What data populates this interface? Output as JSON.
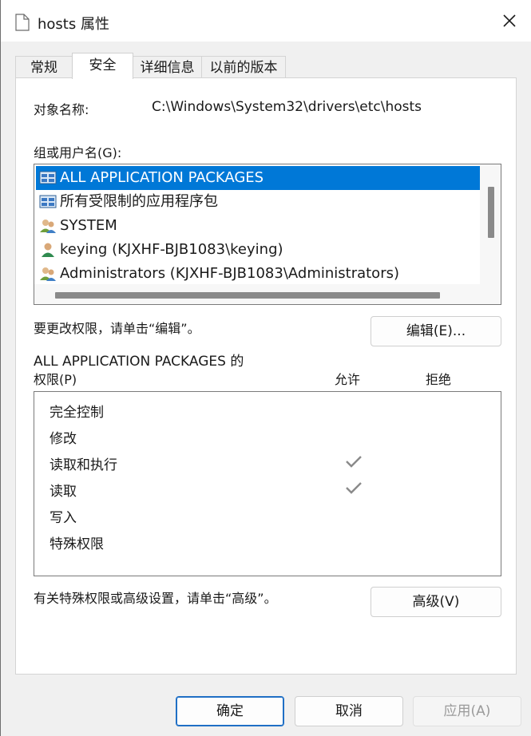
{
  "window": {
    "title": "hosts 属性"
  },
  "tabs": [
    {
      "label": "常规",
      "active": false
    },
    {
      "label": "安全",
      "active": true
    },
    {
      "label": "详细信息",
      "active": false
    },
    {
      "label": "以前的版本",
      "active": false
    }
  ],
  "security": {
    "object_label": "对象名称:",
    "object_value": "C:\\Windows\\System32\\drivers\\etc\\hosts",
    "groups_label": "组或用户名(G):",
    "groups": [
      {
        "name": "ALL APPLICATION PACKAGES",
        "icon": "app-packages-icon",
        "selected": true
      },
      {
        "name": "所有受限制的应用程序包",
        "icon": "app-packages-icon",
        "selected": false
      },
      {
        "name": "SYSTEM",
        "icon": "user-group-icon",
        "selected": false
      },
      {
        "name": "keying (KJXHF-BJB1083\\keying)",
        "icon": "user-icon",
        "selected": false
      },
      {
        "name": "Administrators (KJXHF-BJB1083\\Administrators)",
        "icon": "user-group-icon",
        "selected": false
      }
    ],
    "edit_hint": "要更改权限，请单击“编辑”。",
    "edit_button": "编辑(E)...",
    "perm_title": "ALL APPLICATION PACKAGES 的",
    "perm_label": "权限(P)",
    "allow_header": "允许",
    "deny_header": "拒绝",
    "permissions": [
      {
        "name": "完全控制",
        "allow": false,
        "deny": false
      },
      {
        "name": "修改",
        "allow": false,
        "deny": false
      },
      {
        "name": "读取和执行",
        "allow": true,
        "deny": false
      },
      {
        "name": "读取",
        "allow": true,
        "deny": false
      },
      {
        "name": "写入",
        "allow": false,
        "deny": false
      },
      {
        "name": "特殊权限",
        "allow": false,
        "deny": false
      }
    ],
    "advanced_hint": "有关特殊权限或高级设置，请单击“高级”。",
    "advanced_button": "高级(V)"
  },
  "footer": {
    "ok": "确定",
    "cancel": "取消",
    "apply": "应用(A)",
    "apply_enabled": false
  },
  "colors": {
    "selection": "#0078d7",
    "check": "#8a8a8a",
    "primary_border": "#1f6fc5"
  }
}
